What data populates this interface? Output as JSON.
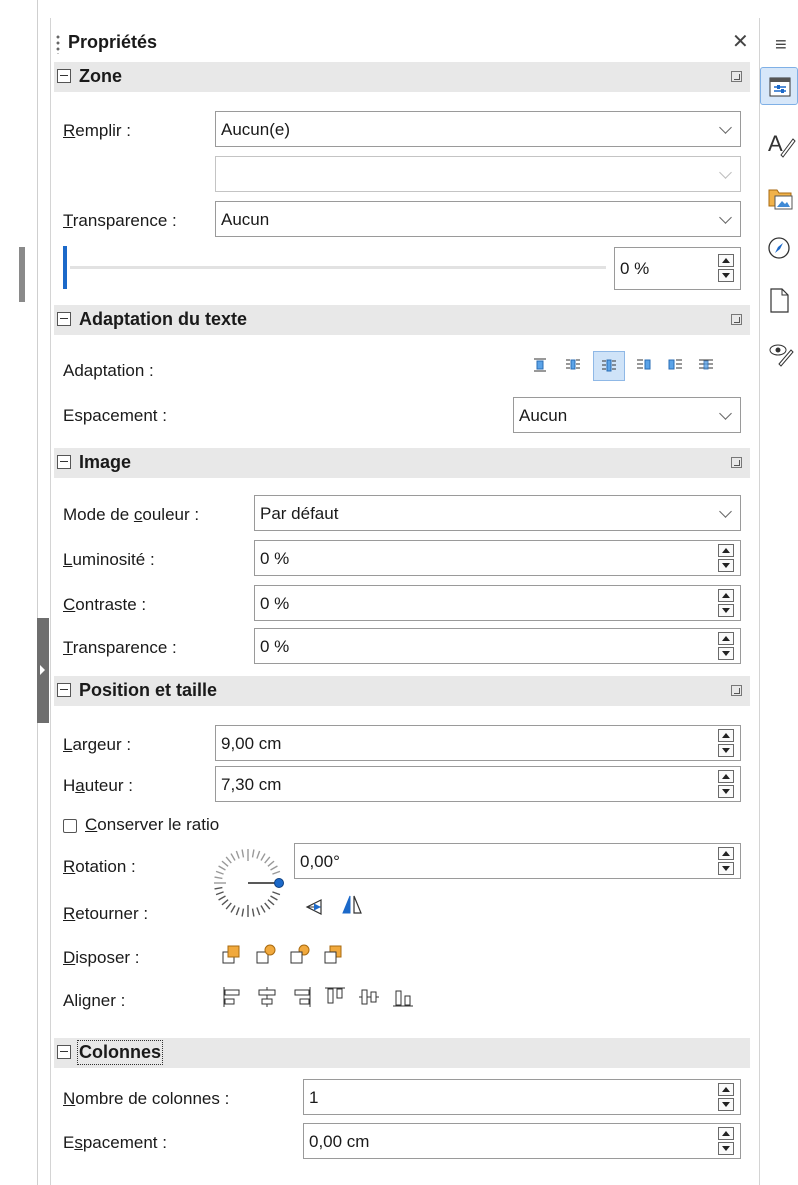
{
  "panel": {
    "title": "Propriétés"
  },
  "sections": {
    "zone": {
      "title": "Zone",
      "fill_label": "Remplir :",
      "fill_value": "Aucun(e)",
      "fill_sub_value": "",
      "transparency_label": "Transparence :",
      "transparency_value": "Aucun",
      "transparency_percent": "0 %",
      "transparency_level": 0
    },
    "text_fit": {
      "title": "Adaptation du texte",
      "fit_label": "Adaptation :",
      "spacing_label": "Espacement :",
      "spacing_value": "Aucun"
    },
    "image": {
      "title": "Image",
      "color_mode_label": "Mode de couleur :",
      "color_mode_value": "Par défaut",
      "brightness_label": "Luminosité :",
      "brightness_value": "0 %",
      "contrast_label": "Contraste :",
      "contrast_value": "0 %",
      "transparency_label": "Transparence :",
      "transparency_value": "0 %"
    },
    "position": {
      "title": "Position et taille",
      "width_label": "Largeur :",
      "width_value": "9,00 cm",
      "height_label": "Hauteur :",
      "height_value": "7,30 cm",
      "keep_ratio_label": "Conserver le ratio",
      "rotation_label": "Rotation :",
      "rotation_value": "0,00°",
      "flip_label": "Retourner :",
      "arrange_label": "Disposer :",
      "align_label": "Aligner :"
    },
    "columns": {
      "title": "Colonnes",
      "count_label": "Nombre de colonnes :",
      "count_value": "1",
      "spacing_label": "Espacement :",
      "spacing_value": "0,00 cm"
    }
  },
  "colors": {
    "accent": "#1c69c9",
    "section_bg": "#e8e8e8",
    "selected_bg": "#cfe3f8"
  }
}
